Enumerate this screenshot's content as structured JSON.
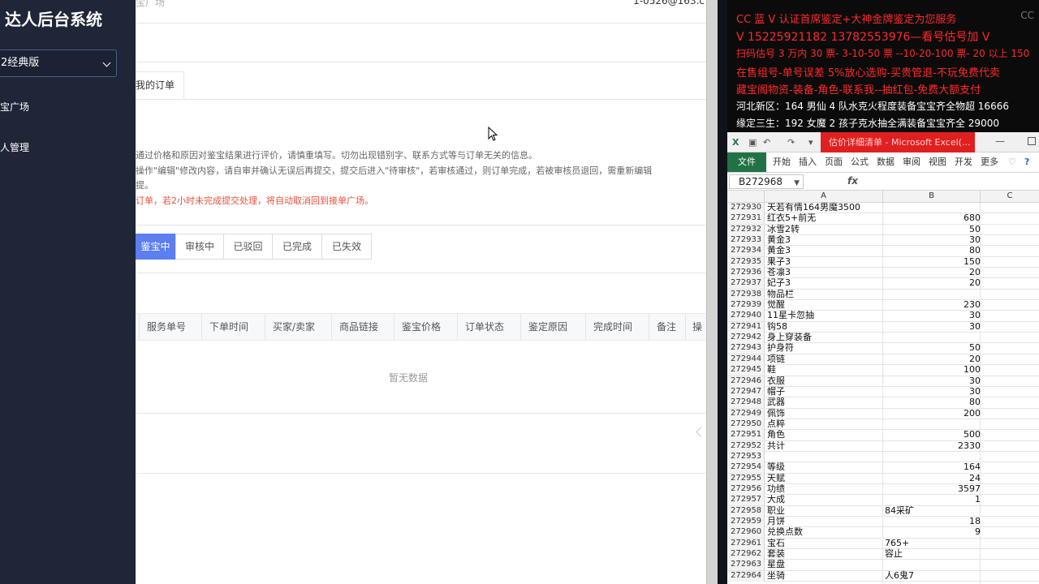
{
  "admin": {
    "app_title": "达人后台系统",
    "version_select": "2经典版",
    "nav": [
      "宝广场",
      "人管理"
    ],
    "breadcrumb": "宝广场",
    "user_email": "1-0526@163.c",
    "tab_my_orders": "我的订单",
    "notices": [
      "通过价格和原因对鉴宝结果进行评价，请慎重填写。切勿出现错别字、联系方式等与订单无关的信息。",
      "操作\"编辑\"修改内容，请自审并确认无误后再提交，提交后进入\"待审核\"，若审核通过，则订单完成，若被审核员退回，需重新编辑",
      "提。",
      "订单，若2小时未完成提交处理，将自动取消回到接单广场。"
    ],
    "status_tabs": [
      "鉴宝中",
      "审核中",
      "已驳回",
      "已完成",
      "已失效"
    ],
    "table_headers": [
      "服务单号",
      "下单时间",
      "买家/卖家",
      "商品链接",
      "鉴宝价格",
      "订单状态",
      "鉴定原因",
      "完成时间",
      "备注",
      "操"
    ],
    "empty_text": "暂无数据"
  },
  "overlay": {
    "lines": [
      "CC 蓝 V 认证首席鉴定+大神金牌鉴定为您服务",
      "V 15225921182    13782553976—看号估号加 V",
      "扫码估号 3 万内 30 票- 3-10-50 票  --10-20-100 票- 20 以上 150",
      "在售组号-单号误差 5%放心选购-买贵管退-不玩免费代卖",
      "藏宝阁物资-装备-角色-联系我--抽红包-免费大额支付",
      "河北新区：164 男仙 4 队水克火程度装备宝宝齐全物超 16666",
      "缘定三生：192 女魔 2 孩子克水抽全满装备宝宝齐全 29000"
    ],
    "watermark": "CC"
  },
  "excel": {
    "title": "估价详细清单 - Microsoft Excel(...",
    "ribbon_tabs": [
      "文件",
      "开始",
      "插入",
      "页面",
      "公式",
      "数据",
      "审阅",
      "视图",
      "开发",
      "更多"
    ],
    "name_box": "B272968",
    "fx": "fx",
    "col_headers": [
      "A",
      "B",
      "C"
    ],
    "rows": [
      {
        "n": "272930",
        "a": "天若有情164男魔3500",
        "b": ""
      },
      {
        "n": "272931",
        "a": "红衣5+前无",
        "b": "680"
      },
      {
        "n": "272932",
        "a": "冰雪2转",
        "b": "50"
      },
      {
        "n": "272933",
        "a": "黄金3",
        "b": "30"
      },
      {
        "n": "272934",
        "a": "黄金3",
        "b": "80"
      },
      {
        "n": "272935",
        "a": "果子3",
        "b": "150"
      },
      {
        "n": "272936",
        "a": "苍凛3",
        "b": "20"
      },
      {
        "n": "272937",
        "a": "妃子3",
        "b": "20"
      },
      {
        "n": "272938",
        "a": "物品栏",
        "b": ""
      },
      {
        "n": "272939",
        "a": "觉醒",
        "b": "230"
      },
      {
        "n": "272940",
        "a": "11星卡忽抽",
        "b": "30"
      },
      {
        "n": "272941",
        "a": "钩58",
        "b": "30"
      },
      {
        "n": "272942",
        "a": "身上穿装备",
        "b": ""
      },
      {
        "n": "272943",
        "a": "护身符",
        "b": "50"
      },
      {
        "n": "272944",
        "a": "项链",
        "b": "20"
      },
      {
        "n": "272945",
        "a": "鞋",
        "b": "100"
      },
      {
        "n": "272946",
        "a": "衣服",
        "b": "30"
      },
      {
        "n": "272947",
        "a": "帽子",
        "b": "30"
      },
      {
        "n": "272948",
        "a": "武器",
        "b": "80"
      },
      {
        "n": "272949",
        "a": "佩饰",
        "b": "200"
      },
      {
        "n": "272950",
        "a": "点粹",
        "b": ""
      },
      {
        "n": "272951",
        "a": "角色",
        "b": "500"
      },
      {
        "n": "272952",
        "a": "共计",
        "b": "2330"
      },
      {
        "n": "272953",
        "a": "",
        "b": ""
      },
      {
        "n": "272954",
        "a": "等级",
        "b": "164"
      },
      {
        "n": "272955",
        "a": "天赋",
        "b": "24"
      },
      {
        "n": "272956",
        "a": "功绩",
        "b": "3597"
      },
      {
        "n": "272957",
        "a": "大成",
        "b": "1"
      },
      {
        "n": "272958",
        "a": "职业",
        "b": "84采矿",
        "t": true
      },
      {
        "n": "272959",
        "a": "月饼",
        "b": "18"
      },
      {
        "n": "272960",
        "a": "兑换点数",
        "b": "9"
      },
      {
        "n": "272961",
        "a": "宝石",
        "b": "765+",
        "t": true
      },
      {
        "n": "272962",
        "a": "套装",
        "b": "容止",
        "t": true
      },
      {
        "n": "272963",
        "a": "星盘",
        "b": ""
      },
      {
        "n": "272964",
        "a": "坐骑",
        "b": "人6鬼7",
        "t": true
      }
    ]
  },
  "colors": {
    "sidebar_bg": "#1e2637",
    "accent": "#5b7ef0",
    "notice_red": "#e8503e",
    "overlay_red": "#ff2a2a",
    "excel_green": "#217346",
    "excel_title_red": "#e02020"
  }
}
